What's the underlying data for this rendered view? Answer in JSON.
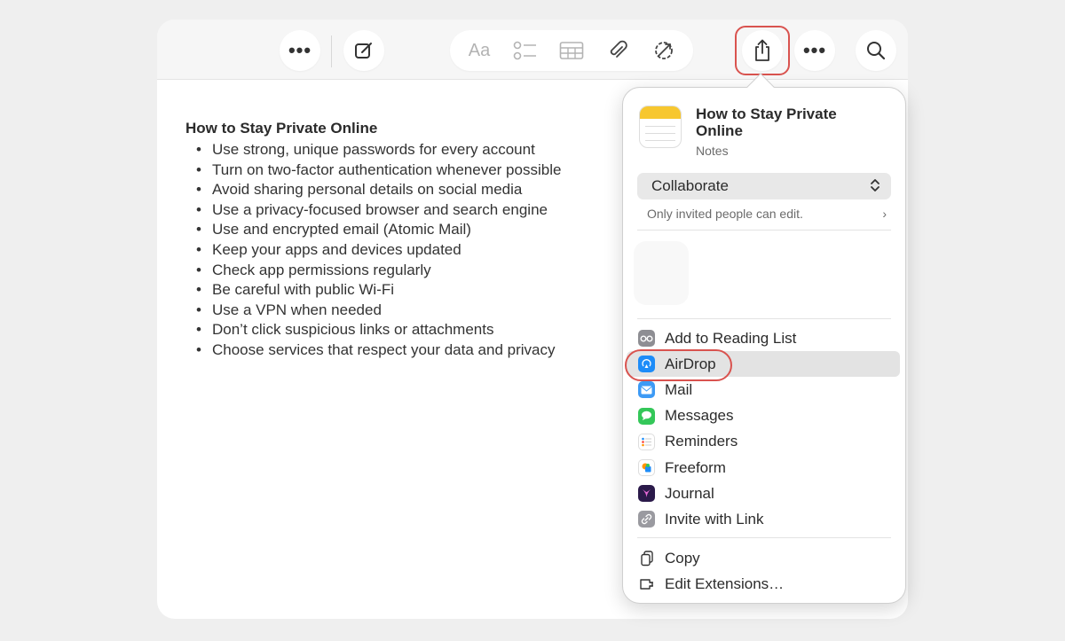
{
  "toolbar": {
    "more_left_label": "•••",
    "compose_icon": "compose-icon",
    "format_label": "Aa",
    "checklist_icon": "checklist-icon",
    "table_icon": "table-icon",
    "attach_icon": "paperclip-icon",
    "collab_icon": "collaboration-icon",
    "share_icon": "share-icon",
    "more_right_label": "•••",
    "search_icon": "search-icon"
  },
  "note": {
    "title": "How to Stay Private Online",
    "items": [
      "Use strong, unique passwords for every account",
      "Turn on two-factor authentication whenever possible",
      "Avoid sharing personal details on social media",
      "Use a privacy-focused browser and search engine",
      "Use and encrypted email (Atomic Mail)",
      "Keep your apps and devices updated",
      "Check app permissions regularly",
      "Be careful with public Wi-Fi",
      "Use a VPN when needed",
      "Don’t click suspicious links or attachments",
      "Choose services that respect your data and privacy"
    ]
  },
  "share_popover": {
    "title": "How to Stay Private Online",
    "subtitle": "Notes",
    "collaborate_label": "Collaborate",
    "collaborate_chevron": "⌃⌄",
    "permission_text": "Only invited people can edit.",
    "permission_chevron": "›",
    "menu_items": [
      {
        "label": "Add to Reading List",
        "icon": "reading-list-icon"
      },
      {
        "label": "AirDrop",
        "icon": "airdrop-icon"
      },
      {
        "label": "Mail",
        "icon": "mail-icon"
      },
      {
        "label": "Messages",
        "icon": "messages-icon"
      },
      {
        "label": "Reminders",
        "icon": "reminders-icon"
      },
      {
        "label": "Freeform",
        "icon": "freeform-icon"
      },
      {
        "label": "Journal",
        "icon": "journal-icon"
      },
      {
        "label": "Invite with Link",
        "icon": "link-icon"
      }
    ],
    "secondary_items": [
      {
        "label": "Copy",
        "icon": "copy-icon"
      },
      {
        "label": "Edit Extensions…",
        "icon": "extensions-icon"
      }
    ]
  },
  "colors": {
    "highlight_red": "#d9534f",
    "notes_yellow": "#f7c72f",
    "airdrop_blue": "#1d8cf8",
    "messages_green": "#34c759"
  }
}
